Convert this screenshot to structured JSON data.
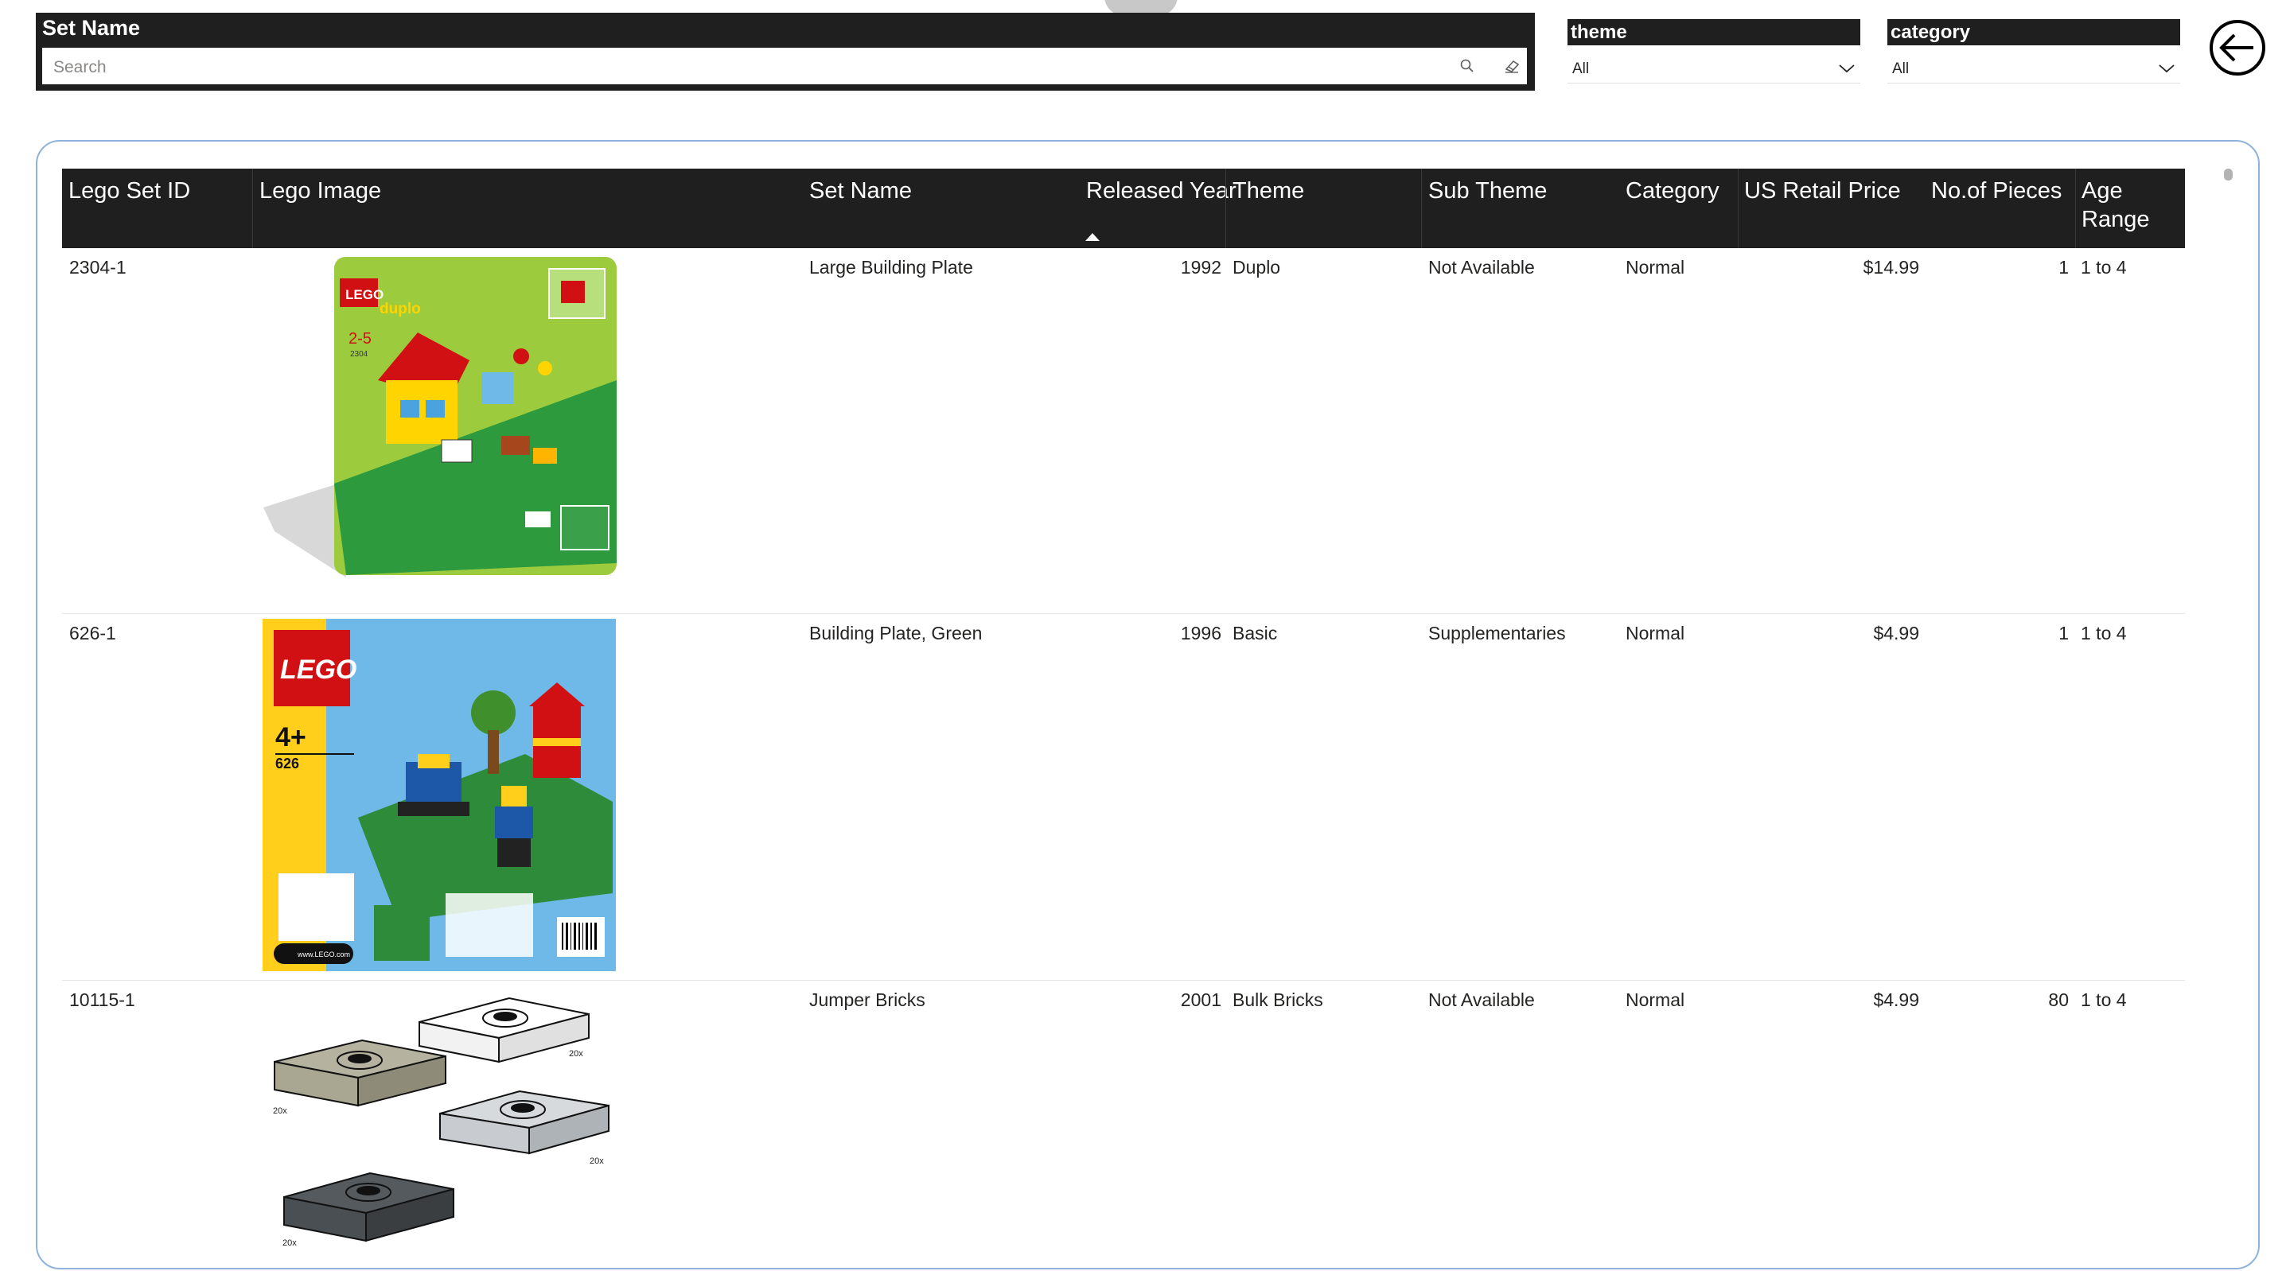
{
  "search_slicer": {
    "title": "Set Name",
    "placeholder": "Search"
  },
  "theme_slicer": {
    "title": "theme",
    "value": "All"
  },
  "category_slicer": {
    "title": "category",
    "value": "All"
  },
  "table": {
    "columns": [
      "Lego Set ID",
      "Lego Image",
      "Set Name",
      "Released Year",
      "Theme",
      "Sub Theme",
      "Category",
      "US Retail Price",
      "No.of Pieces",
      "Age Range"
    ],
    "sort_column": "Released Year",
    "sort_direction": "ascending",
    "rows": [
      {
        "id": "2304-1",
        "image_icon": "duplo-large-building-plate-box-image",
        "name": "Large Building Plate",
        "year": "1992",
        "theme": "Duplo",
        "sub_theme": "Not Available",
        "category": "Normal",
        "price": "$14.99",
        "pieces": "1",
        "age": "1 to 4"
      },
      {
        "id": "626-1",
        "image_icon": "lego-building-plate-green-box-image",
        "name": "Building Plate, Green",
        "year": "1996",
        "theme": "Basic",
        "sub_theme": "Supplementaries",
        "category": "Normal",
        "price": "$4.99",
        "pieces": "1",
        "age": "1 to 4"
      },
      {
        "id": "10115-1",
        "image_icon": "jumper-bricks-image",
        "name": "Jumper Bricks",
        "year": "2001",
        "theme": "Bulk Bricks",
        "sub_theme": "Not Available",
        "category": "Normal",
        "price": "$4.99",
        "pieces": "80",
        "age": "1 to 4"
      }
    ]
  },
  "image_text": {
    "duplo_logo": "LEGO",
    "duplo_brand": "duplo",
    "duplo_age": "2-5",
    "duplo_num": "2304",
    "basic_logo": "LEGO",
    "basic_age": "4+",
    "basic_num": "626",
    "basic_url": "www.LEGO.com",
    "jumper_qty": "20x"
  },
  "colors": {
    "header_bg": "#1f1f1f",
    "card_border": "#8fb2dc",
    "lego_red": "#d01012",
    "plate_green": "#2e8b3a"
  }
}
